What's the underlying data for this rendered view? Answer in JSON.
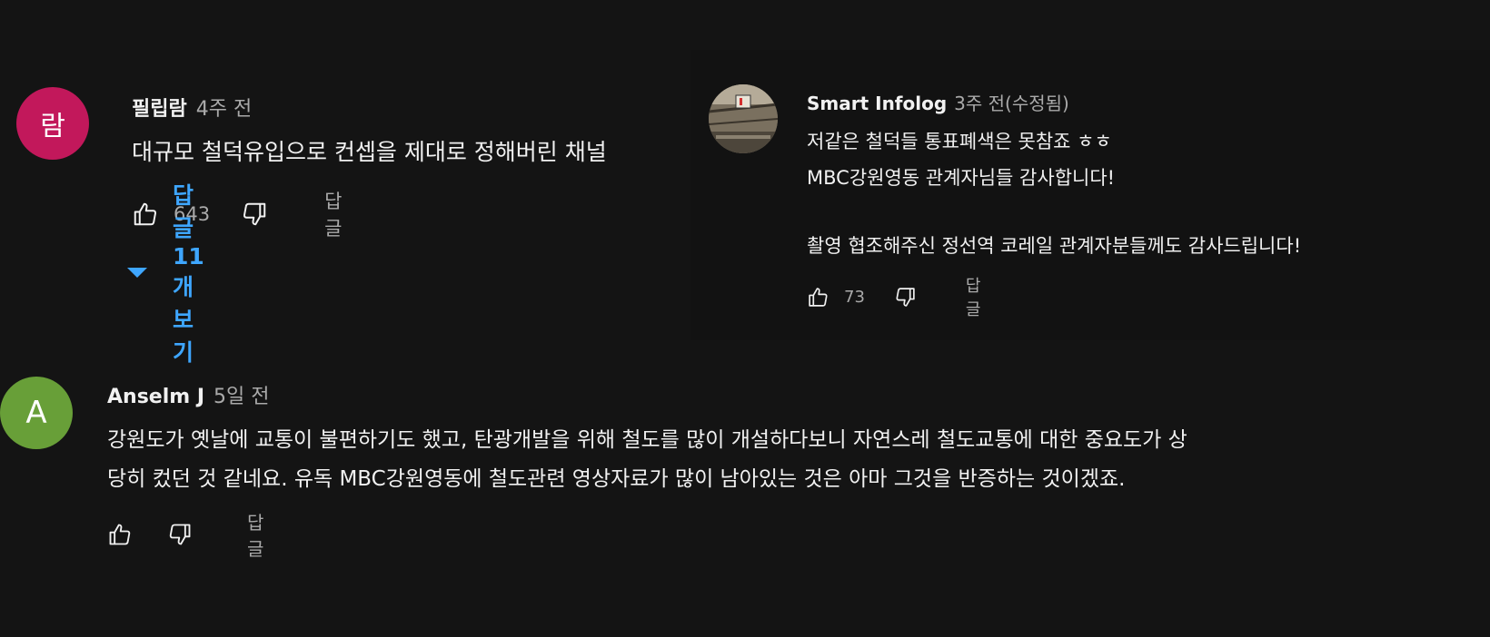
{
  "comments": [
    {
      "avatar_letter": "람",
      "avatar_color": "#c2185b",
      "author": "필립람",
      "time": "4주 전",
      "lines": [
        "대규모 철덕유입으로 컨셉을 제대로 정해버린 채널"
      ],
      "likes": "643",
      "reply_label": "답글",
      "view_replies": "답글 11개 보기"
    },
    {
      "avatar_color": "#6b6252",
      "author": "Smart Infolog",
      "time": "3주 전(수정됨)",
      "lines": [
        "저같은 철덕들 통표폐색은 못참죠 ㅎㅎ",
        "MBC강원영동 관계자님들 감사합니다!",
        "",
        "촬영 협조해주신 정선역 코레일 관계자분들께도 감사드립니다!"
      ],
      "likes": "73",
      "reply_label": "답글"
    },
    {
      "avatar_letter": "A",
      "avatar_color": "#689f38",
      "author": "Anselm J",
      "time": "5일 전",
      "lines": [
        "강원도가 옛날에 교통이 불편하기도 했고, 탄광개발을 위해 철도를 많이 개설하다보니 자연스레 철도교통에 대한 중요도가 상",
        "당히 컸던 것 같네요. 유독 MBC강원영동에 철도관련 영상자료가 많이 남아있는 것은 아마 그것을 반증하는 것이겠죠."
      ],
      "reply_label": "답글"
    }
  ],
  "colors": {
    "link": "#3ea6ff",
    "muted": "#aaaaaa",
    "text": "#f1f1f1"
  },
  "icons": {
    "like": "thumbs-up-icon",
    "dislike": "thumbs-down-icon",
    "expand": "caret-down-icon"
  }
}
